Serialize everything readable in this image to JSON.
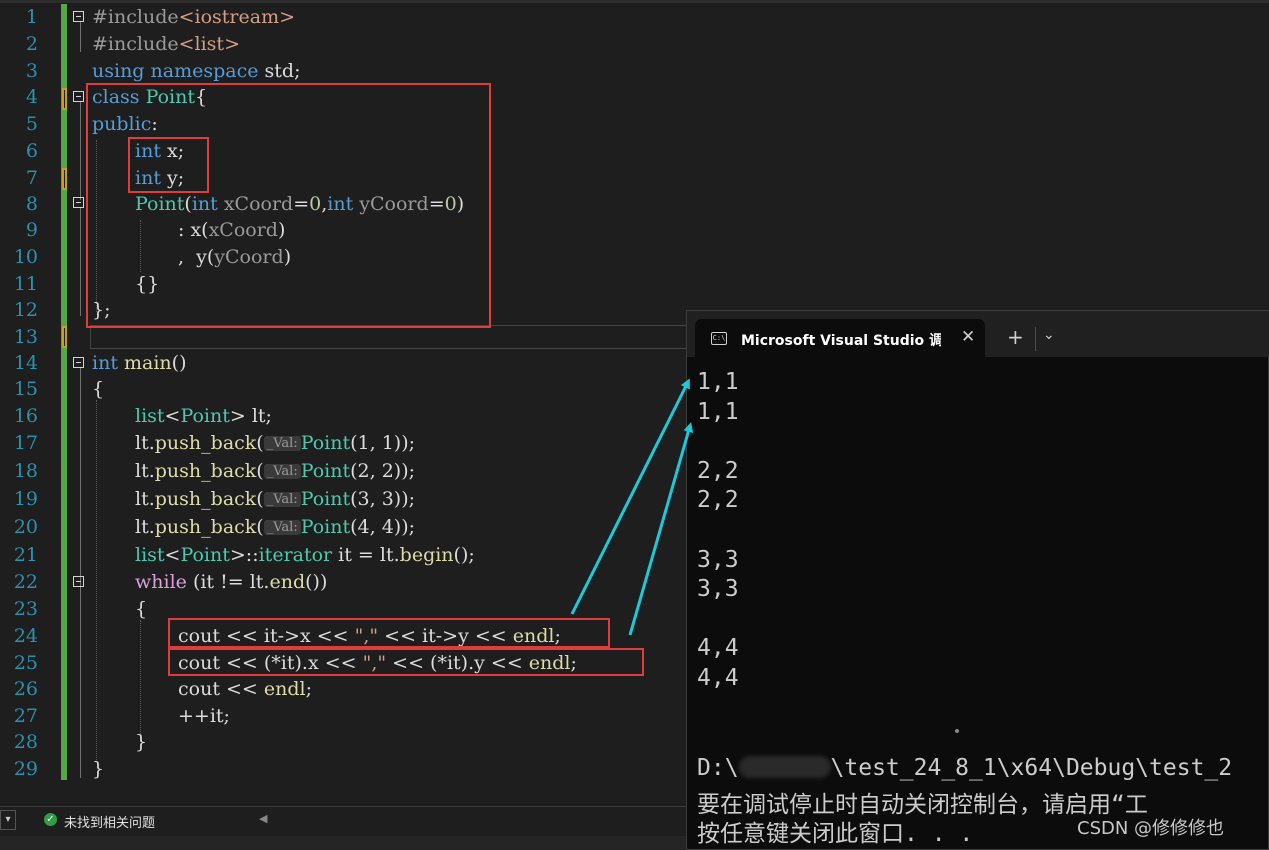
{
  "line_numbers": [
    "1",
    "2",
    "3",
    "4",
    "5",
    "6",
    "7",
    "8",
    "9",
    "10",
    "11",
    "12",
    "13",
    "14",
    "15",
    "16",
    "17",
    "18",
    "19",
    "20",
    "21",
    "22",
    "23",
    "24",
    "25",
    "26",
    "27",
    "28",
    "29"
  ],
  "code": {
    "l1": {
      "pp": "#include",
      "inc": "<iostream>"
    },
    "l2": {
      "pp": "#include",
      "inc": "<list>"
    },
    "l3": {
      "kw1": "using",
      "kw2": "namespace",
      "rest": "std;"
    },
    "l4": {
      "kw": "class",
      "ty": "Point",
      "rest": "{"
    },
    "l5": {
      "kw": "public",
      "rest": ":"
    },
    "l6": {
      "kw": "int",
      "rest": "x;"
    },
    "l7": {
      "kw": "int",
      "rest": "y;"
    },
    "l8": {
      "ty": "Point",
      "p1": "(",
      "kw1": "int",
      "param1": "xCoord",
      "eq1": "=",
      "n1": "0",
      "comma": ",",
      "kw2": "int",
      "param2": "yCoord",
      "eq2": "=",
      "n2": "0",
      "p2": ")"
    },
    "l9": {
      "lead": ": ",
      "mem": "x",
      "p1": "(",
      "param": "xCoord",
      "p2": ")"
    },
    "l10": {
      "lead": ",  ",
      "mem": "y",
      "p1": "(",
      "param": "yCoord",
      "p2": ")"
    },
    "l11": {
      "rest": "{}"
    },
    "l12": {
      "rest": "};"
    },
    "l14": {
      "kw": "int",
      "fn": "main",
      "rest": "()"
    },
    "l15": {
      "rest": "{"
    },
    "l16": {
      "ty1": "list",
      "lt": "<",
      "ty2": "Point",
      "gt": ">",
      "rest": " lt;"
    },
    "l17": {
      "obj": "lt.",
      "fn": "push_back",
      "p1": "(",
      "hint": "_Val:",
      "ty": "Point",
      "args": "(1, 1));"
    },
    "l18": {
      "obj": "lt.",
      "fn": "push_back",
      "p1": "(",
      "hint": "_Val:",
      "ty": "Point",
      "args": "(2, 2));"
    },
    "l19": {
      "obj": "lt.",
      "fn": "push_back",
      "p1": "(",
      "hint": "_Val:",
      "ty": "Point",
      "args": "(3, 3));"
    },
    "l20": {
      "obj": "lt.",
      "fn": "push_back",
      "p1": "(",
      "hint": "_Val:",
      "ty": "Point",
      "args": "(4, 4));"
    },
    "l21": {
      "ty1": "list",
      "lt": "<",
      "ty2": "Point",
      "gt": ">",
      "sep": "::",
      "ty3": "iterator",
      "rest1": " it = lt.",
      "fn": "begin",
      "rest2": "();"
    },
    "l22": {
      "kw": "while",
      "rest1": " (it != lt.",
      "fn": "end",
      "rest2": "())"
    },
    "l23": {
      "rest": "{"
    },
    "l24": {
      "a": "cout << it->",
      "b": "x",
      "c": " << ",
      "str": "\",\"",
      "d": " << it->",
      "e": "y",
      "f": " << ",
      "g": "endl",
      "h": ";"
    },
    "l25": {
      "a": "cout << (*it).",
      "b": "x",
      "c": " << ",
      "str": "\",\"",
      "d": " << (*it).",
      "e": "y",
      "f": " << ",
      "g": "endl",
      "h": ";"
    },
    "l26": {
      "a": "cout << ",
      "g": "endl",
      "h": ";"
    },
    "l27": {
      "rest": "++it;"
    },
    "l28": {
      "rest": "}"
    },
    "l29": {
      "rest": "}"
    }
  },
  "status": {
    "left_button": "▾",
    "check_icon": "check-circle-icon",
    "message": "未找到相关问题",
    "scroll_arrow": "◀"
  },
  "terminal": {
    "tab_icon_text": "C:\\",
    "tab_title": "Microsoft Visual Studio 调试控制台",
    "close_glyph": "✕",
    "new_tab_glyph": "+",
    "dropdown_glyph": "⌄",
    "output": [
      "1,1",
      "1,1",
      "",
      "2,2",
      "2,2",
      "",
      "3,3",
      "3,3",
      "",
      "4,4",
      "4,4"
    ],
    "path_prefix": "D:\\",
    "path_suffix": "\\test_24_8_1\\x64\\Debug\\test_2",
    "msg1": "要在调试停止时自动关闭控制台，请启用“工",
    "msg2": "按任意键关闭此窗口. . .",
    "watermark": "CSDN @修修修也"
  },
  "colors": {
    "annotation_red": "#e03c3c",
    "arrow_cyan": "#1ec8d8",
    "gutter_green": "#57a64a"
  }
}
